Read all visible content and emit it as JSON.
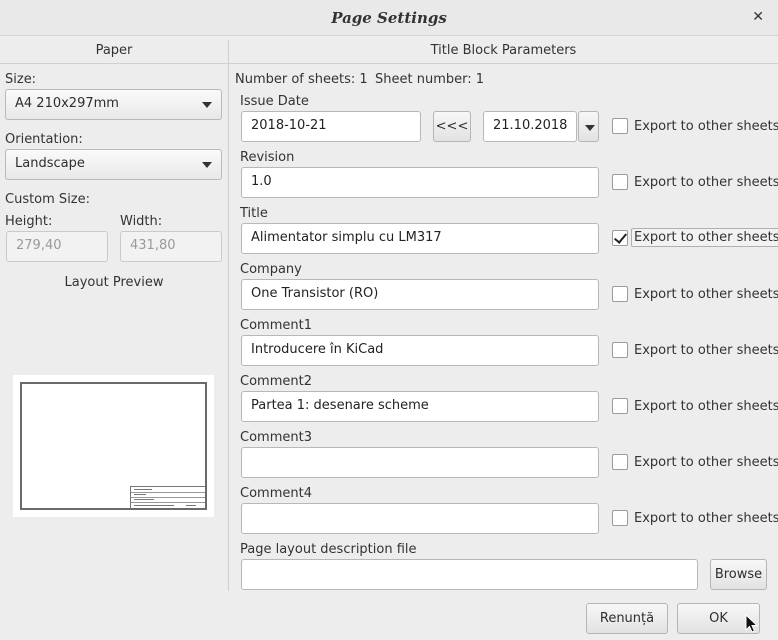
{
  "window": {
    "title": "Page Settings"
  },
  "paper": {
    "heading": "Paper",
    "size_label": "Size:",
    "size_value": "A4 210x297mm",
    "orientation_label": "Orientation:",
    "orientation_value": "Landscape",
    "custom_size_label": "Custom Size:",
    "height_label": "Height:",
    "height_value": "279,40",
    "width_label": "Width:",
    "width_value": "431,80",
    "layout_preview_label": "Layout Preview"
  },
  "title_block": {
    "heading": "Title Block Parameters",
    "num_sheets_text": "Number of sheets: 1",
    "sheet_number_text": "Sheet number: 1",
    "issue_date_label": "Issue Date",
    "issue_date_value": "2018-10-21",
    "copy_date_button": "<<<",
    "date_picker_value": "21.10.2018",
    "export_label": "Export to other sheets",
    "revision_label": "Revision",
    "revision_value": "1.0",
    "title_label": "Title",
    "title_value": "Alimentator simplu cu LM317",
    "company_label": "Company",
    "company_value": "One Transistor (RO)",
    "comment1_label": "Comment1",
    "comment1_value": "Introducere în KiCad",
    "comment2_label": "Comment2",
    "comment2_value": "Partea 1: desenare scheme",
    "comment3_label": "Comment3",
    "comment3_value": "",
    "comment4_label": "Comment4",
    "comment4_value": "",
    "layout_file_label": "Page layout description file",
    "layout_file_value": "",
    "browse_button": "Browse"
  },
  "export_checked": {
    "issue_date": false,
    "revision": false,
    "title": true,
    "company": false,
    "comment1": false,
    "comment2": false,
    "comment3": false,
    "comment4": false
  },
  "buttons": {
    "cancel": "Renunță",
    "ok": "OK"
  }
}
